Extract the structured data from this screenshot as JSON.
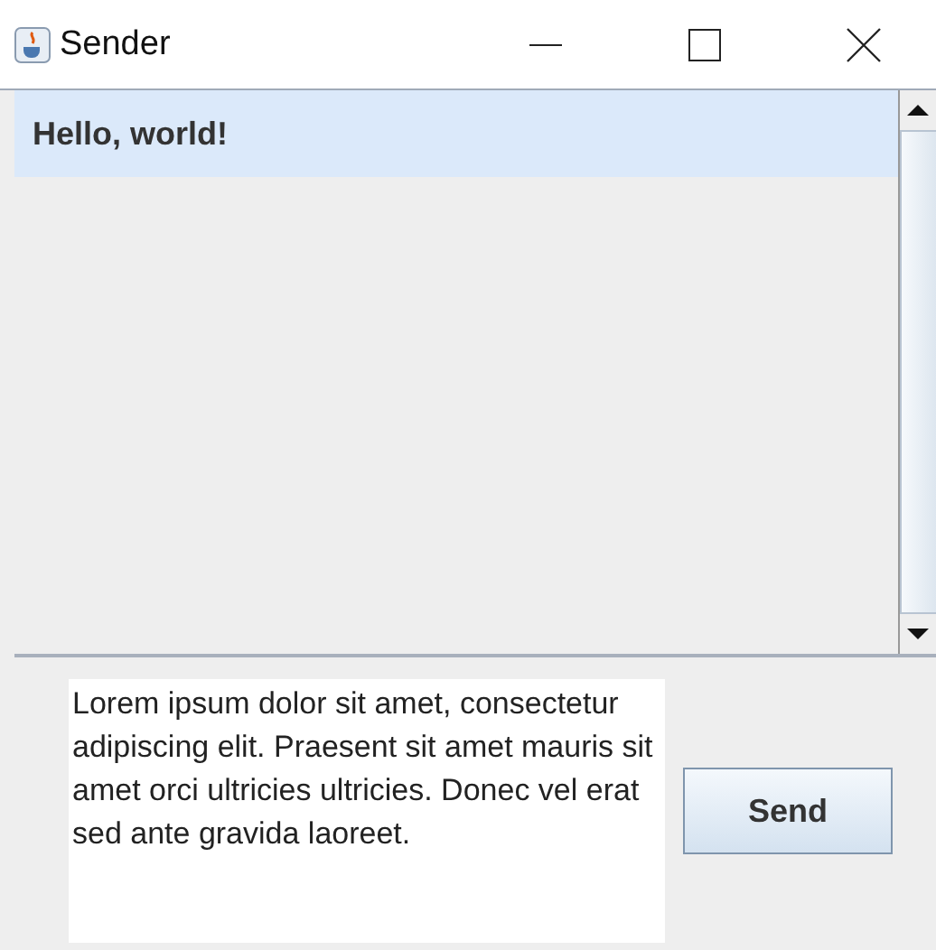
{
  "window": {
    "title": "Sender"
  },
  "messages": [
    {
      "text": "Hello, world!",
      "selected": true
    }
  ],
  "composer": {
    "value": "Lorem ipsum dolor sit amet, consectetur adipiscing elit. Praesent sit amet mauris sit amet orci ultricies ultricies. Donec vel erat sed ante gravida laoreet."
  },
  "buttons": [
    {
      "label": "Send"
    }
  ]
}
